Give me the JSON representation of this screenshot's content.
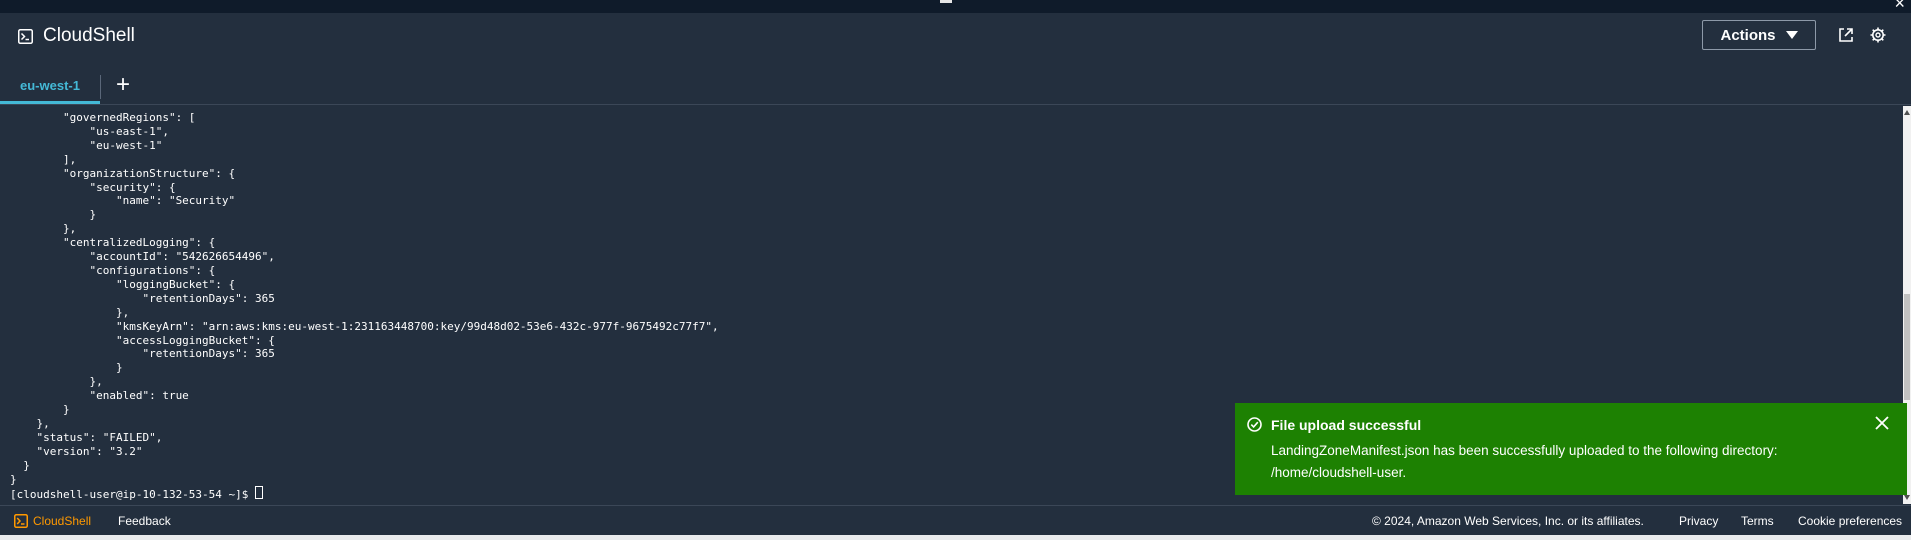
{
  "header": {
    "title": "CloudShell",
    "actions_label": "Actions",
    "icons": [
      "cloudshell-icon",
      "external-link-icon",
      "gear-icon"
    ]
  },
  "tabs": [
    {
      "label": "eu-west-1",
      "active": true
    }
  ],
  "add_tab": "+",
  "terminal": {
    "lines": [
      "        \"governedRegions\": [",
      "            \"us-east-1\",",
      "            \"eu-west-1\"",
      "        ],",
      "        \"organizationStructure\": {",
      "            \"security\": {",
      "                \"name\": \"Security\"",
      "            }",
      "        },",
      "        \"centralizedLogging\": {",
      "            \"accountId\": \"542626654496\",",
      "            \"configurations\": {",
      "                \"loggingBucket\": {",
      "                    \"retentionDays\": 365",
      "                },",
      "                \"kmsKeyArn\": \"arn:aws:kms:eu-west-1:231163448700:key/99d48d02-53e6-432c-977f-9675492c77f7\",",
      "                \"accessLoggingBucket\": {",
      "                    \"retentionDays\": 365",
      "                }",
      "            },",
      "            \"enabled\": true",
      "        }",
      "    },",
      "    \"status\": \"FAILED\",",
      "    \"version\": \"3.2\"",
      "  }",
      "}"
    ],
    "prompt": "[cloudshell-user@ip-10-132-53-54 ~]$ "
  },
  "toast": {
    "title": "File upload successful",
    "message": "LandingZoneManifest.json has been successfully uploaded to the following directory: /home/cloudshell-user.",
    "color": "#1d8102"
  },
  "footer": {
    "brand": "CloudShell",
    "feedback": "Feedback",
    "copyright": "© 2024, Amazon Web Services, Inc. or its affiliates.",
    "privacy": "Privacy",
    "terms": "Terms",
    "cookie": "Cookie preferences"
  },
  "colors": {
    "background": "#232f3e",
    "accent": "#44b9d6",
    "brand_orange": "#ff9900",
    "success": "#1d8102"
  }
}
